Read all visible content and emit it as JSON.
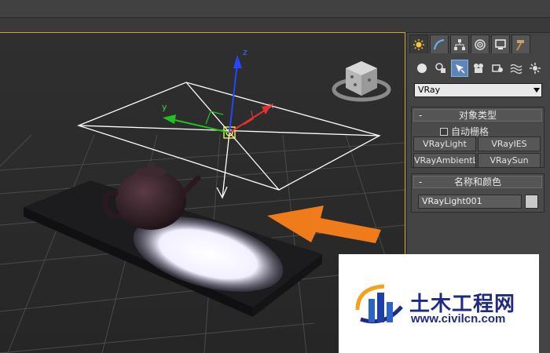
{
  "app": {
    "accent_viewport_border": "#c9a531",
    "watermark_brand_color": "#1f2b80",
    "arrow_color": "#f07b1a"
  },
  "viewport": {
    "icons": [
      "viewcube-icon",
      "light-gizmo-icon",
      "arrow-annotation-icon"
    ],
    "axes": {
      "x": "x",
      "y": "y",
      "z": "z"
    }
  },
  "command_panel": {
    "tabs": [
      {
        "name": "create",
        "icon": "sun-icon",
        "active": true
      },
      {
        "name": "modify",
        "icon": "curve-icon"
      },
      {
        "name": "hierarchy",
        "icon": "hierarchy-icon"
      },
      {
        "name": "motion",
        "icon": "motion-icon"
      },
      {
        "name": "display",
        "icon": "monitor-icon"
      },
      {
        "name": "utilities",
        "icon": "hammer-icon"
      }
    ],
    "sub_icons": [
      {
        "name": "geometry",
        "icon": "sphere-icon"
      },
      {
        "name": "shapes",
        "icon": "shapes-icon"
      },
      {
        "name": "lights",
        "icon": "light-icon",
        "active": true
      },
      {
        "name": "cameras",
        "icon": "camera-icon"
      },
      {
        "name": "helpers",
        "icon": "helper-icon"
      },
      {
        "name": "spacewarps",
        "icon": "wave-icon"
      },
      {
        "name": "systems",
        "icon": "gear-icon"
      }
    ],
    "category_dropdown": {
      "value": "VRay"
    },
    "object_type": {
      "title": "对象类型",
      "collapse": "-",
      "autogrid_label": "自动栅格",
      "buttons": [
        "VRayLight",
        "VRayIES",
        "VRayAmbientLight",
        "VRaySun"
      ]
    },
    "name_color": {
      "title": "名称和颜色",
      "collapse": "-",
      "name_value": "VRayLight001",
      "swatch_color": "#c9c9c9"
    }
  },
  "watermark": {
    "title": "土木工程网",
    "url": "www.civilcn.com"
  }
}
